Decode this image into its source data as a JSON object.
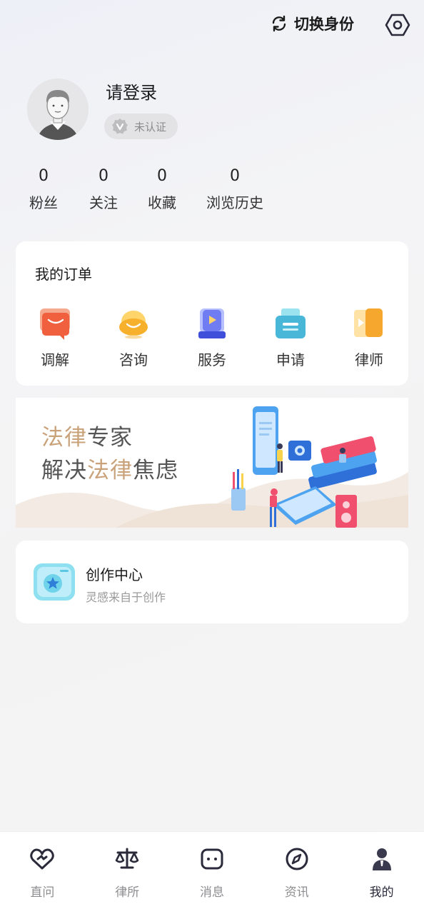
{
  "header": {
    "switch_label": "切换身份",
    "icons": {
      "switch": "refresh-icon",
      "settings": "hexagon-settings-icon"
    }
  },
  "profile": {
    "login_text": "请登录",
    "verify_label": "未认证",
    "stats": [
      {
        "value": "0",
        "label": "粉丝"
      },
      {
        "value": "0",
        "label": "关注"
      },
      {
        "value": "0",
        "label": "收藏"
      },
      {
        "value": "0",
        "label": "浏览历史"
      }
    ]
  },
  "orders": {
    "title": "我的订单",
    "items": [
      {
        "label": "调解",
        "icon": "mediation-icon",
        "color": "#f0603e"
      },
      {
        "label": "咨询",
        "icon": "consult-icon",
        "color": "#f6b02c"
      },
      {
        "label": "服务",
        "icon": "service-icon",
        "color": "#4a5fe6"
      },
      {
        "label": "申请",
        "icon": "apply-icon",
        "color": "#49b7d8"
      },
      {
        "label": "律师",
        "icon": "lawyer-icon",
        "color": "#f6a72d"
      }
    ]
  },
  "banner": {
    "line1_gold": "法律",
    "line1_rest": "专家",
    "line2_a": "解决",
    "line2_gold": "法律",
    "line2_b": "焦虑"
  },
  "creator": {
    "title": "创作中心",
    "subtitle": "灵感来自于创作",
    "icon": "star-folder-icon"
  },
  "tabbar": {
    "tabs": [
      {
        "label": "直问",
        "icon": "heart-chat-icon",
        "active": false
      },
      {
        "label": "律所",
        "icon": "scales-icon",
        "active": false
      },
      {
        "label": "消息",
        "icon": "message-icon",
        "active": false
      },
      {
        "label": "资讯",
        "icon": "compass-icon",
        "active": false
      },
      {
        "label": "我的",
        "icon": "user-icon",
        "active": true
      }
    ]
  },
  "colors": {
    "accent": "#2a2a3a",
    "gold": "#c9a27a",
    "tab_inactive": "#8d8d90"
  }
}
